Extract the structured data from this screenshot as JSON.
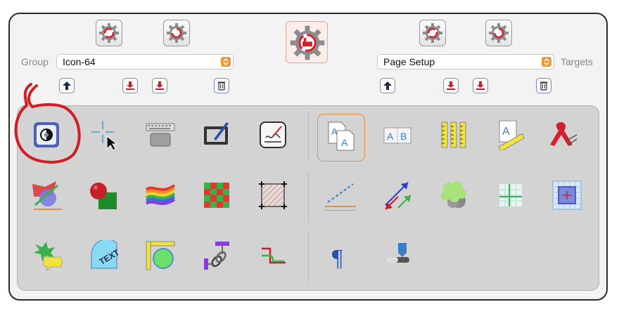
{
  "group": {
    "label": "Group",
    "value": "Icon-64"
  },
  "targets": {
    "label": "Targets",
    "value": "Page Setup"
  },
  "toolbar_icons": [
    "gear-icon",
    "up-arrow-icon",
    "download-icon",
    "trash-icon"
  ],
  "colors": {
    "accent_orange": "#e6913c",
    "red": "#d4202c",
    "panel": "#d3d3d3"
  },
  "palette": {
    "rows": [
      [
        "appearance-icon",
        "crosshair-cursor-icon",
        "keyboard-icon",
        "tablet-pen-icon",
        "signature-icon",
        "page-setup-icon",
        "page-columns-icon",
        "rulers-icon",
        "text-ruler-icon",
        "ribbon-icon"
      ],
      [
        "shape-layers-icon",
        "ball-cube-icon",
        "rainbow-flag-icon",
        "checkerboard-icon",
        "crop-frame-icon",
        "dashed-line-icon",
        "arrows-icon",
        "cloud-shape-icon",
        "grid-cross-icon",
        "grid-frame-icon"
      ],
      [
        "comment-bubbles-icon",
        "text-arc-icon",
        "ruler-circle-icon",
        "chain-link-icon",
        "step-line-icon",
        "pilcrow-icon",
        "slider-icon"
      ]
    ]
  }
}
